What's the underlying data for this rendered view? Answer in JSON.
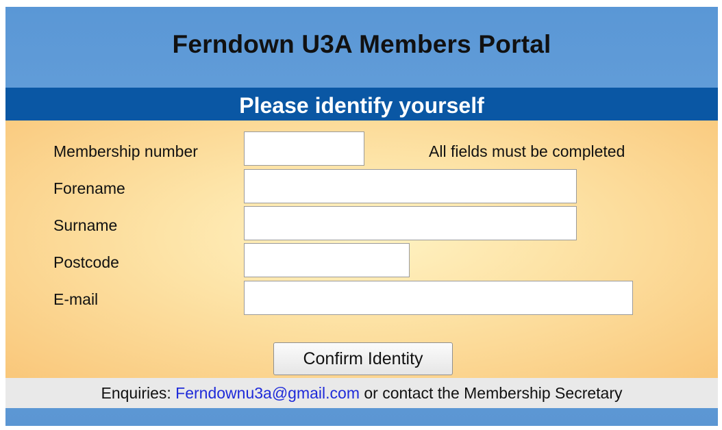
{
  "header": {
    "title": "Ferndown U3A Members Portal"
  },
  "banner": {
    "text": "Please identify yourself"
  },
  "form": {
    "note": "All fields must be completed",
    "membership_label": "Membership number",
    "membership_value": "",
    "forename_label": "Forename",
    "forename_value": "",
    "surname_label": "Surname",
    "surname_value": "",
    "postcode_label": "Postcode",
    "postcode_value": "",
    "email_label": "E-mail",
    "email_value": "",
    "submit_label": "Confirm Identity"
  },
  "footer": {
    "prefix": "Enquiries: ",
    "email_link": "Ferndownu3a@gmail.com",
    "suffix": " or contact the Membership Secretary"
  },
  "colors": {
    "page_background": "#ffffff",
    "portal_background": "#5a97d6",
    "banner_background": "#0a57a4",
    "form_panel_center": "#fff3c4",
    "form_panel_edge": "#f9c77a",
    "footer_background": "#e9e9e9",
    "link": "#1f2bd9"
  }
}
